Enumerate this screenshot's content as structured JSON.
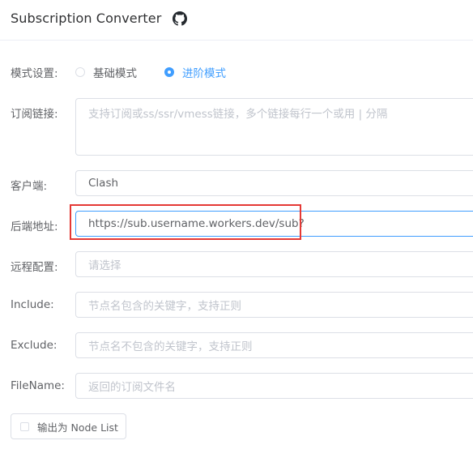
{
  "header": {
    "title": "Subscription Converter",
    "icon": "github-icon"
  },
  "mode": {
    "label": "模式设置:",
    "options": [
      {
        "label": "基础模式",
        "checked": false
      },
      {
        "label": "进阶模式",
        "checked": true
      }
    ]
  },
  "subscription": {
    "label": "订阅链接:",
    "placeholder": "支持订阅或ss/ssr/vmess链接，多个链接每行一个或用 | 分隔"
  },
  "client": {
    "label": "客户端:",
    "value": "Clash"
  },
  "backend": {
    "label": "后端地址:",
    "value": "https://sub.username.workers.dev/sub?"
  },
  "remote_config": {
    "label": "远程配置:",
    "placeholder": "请选择"
  },
  "include": {
    "label": "Include:",
    "placeholder": "节点名包含的关键字，支持正则"
  },
  "exclude": {
    "label": "Exclude:",
    "placeholder": "节点名不包含的关键字，支持正则"
  },
  "filename": {
    "label": "FileName:",
    "placeholder": "返回的订阅文件名"
  },
  "node_list": {
    "label": "输出为 Node List",
    "checked": false
  },
  "colors": {
    "accent": "#409eff",
    "highlight": "#e53935",
    "border": "#dcdfe6",
    "placeholder": "#c0c4cc"
  }
}
